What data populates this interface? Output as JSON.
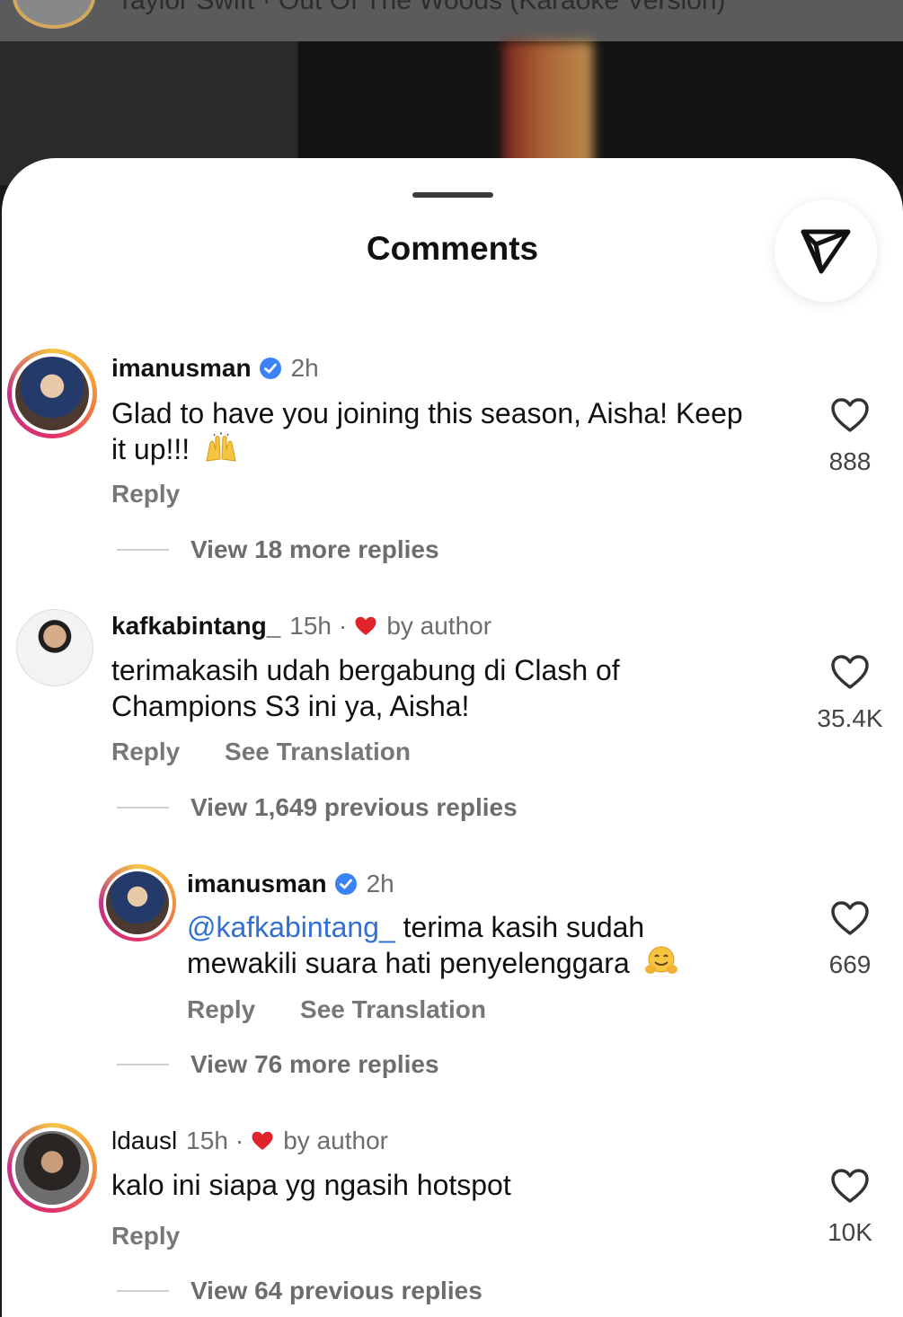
{
  "music": {
    "text": "Taylor Swift · Out Of The Woods (Karaoke Version)"
  },
  "sheet": {
    "title": "Comments"
  },
  "comments": [
    {
      "username": "imanusman",
      "verified": true,
      "time": "2h",
      "text": "Glad to have you joining this season, Aisha! Keep it up!!!",
      "emoji": "raising-hands-emoji",
      "reply": "Reply",
      "likes": "888",
      "view_more": "View 18 more replies"
    },
    {
      "username": "kafkabintang_",
      "time": "15h",
      "separator": "·",
      "liked_by": "by author",
      "text": "terimakasih udah bergabung di Clash of Champions S3 ini ya, Aisha!",
      "reply": "Reply",
      "translate": "See Translation",
      "likes": "35.4K",
      "view_more": "View 1,649 previous replies"
    },
    {
      "username": "imanusman",
      "verified": true,
      "time": "2h",
      "mention": "@kafkabintang_",
      "text": " terima kasih sudah mewakili suara hati penyelenggara",
      "emoji": "hugging-face-emoji",
      "reply": "Reply",
      "translate": "See Translation",
      "likes": "669",
      "view_more": "View 76 more replies"
    },
    {
      "username": "ldausl",
      "time": "15h",
      "separator": "·",
      "liked_by": "by author",
      "text": "kalo ini siapa yg ngasih hotspot",
      "reply": "Reply",
      "likes": "10K",
      "view_more": "View 64 previous replies"
    }
  ],
  "colors": {
    "mention": "#2f6fd6",
    "verified": "#3b82f6",
    "heart": "#e0242c"
  }
}
